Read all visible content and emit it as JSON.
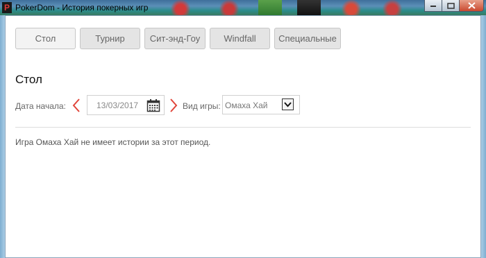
{
  "window": {
    "title": "PokerDom - История покерных игр",
    "app_icon_letter": "P"
  },
  "tabs": [
    {
      "label": "Стол",
      "active": true
    },
    {
      "label": "Турнир",
      "active": false
    },
    {
      "label": "Сит-энд-Гоу",
      "active": false
    },
    {
      "label": "Windfall",
      "active": false
    },
    {
      "label": "Специальные",
      "active": false
    }
  ],
  "section": {
    "heading": "Стол"
  },
  "filters": {
    "start_date_label": "Дата начала:",
    "start_date_value": "13/03/2017",
    "game_type_label": "Вид игры:",
    "game_type_value": "Омаха Хай"
  },
  "message": "Игра Омаха Хай не имеет истории за этот период.",
  "colors": {
    "arrow": "#e0453a",
    "tab_bg": "#e4e4e4",
    "tab_active_bg": "#f3f3f3"
  },
  "icons": {
    "prev": "chevron-left-icon",
    "next": "chevron-right-icon",
    "calendar": "calendar-icon",
    "dropdown": "chevron-down-icon"
  }
}
